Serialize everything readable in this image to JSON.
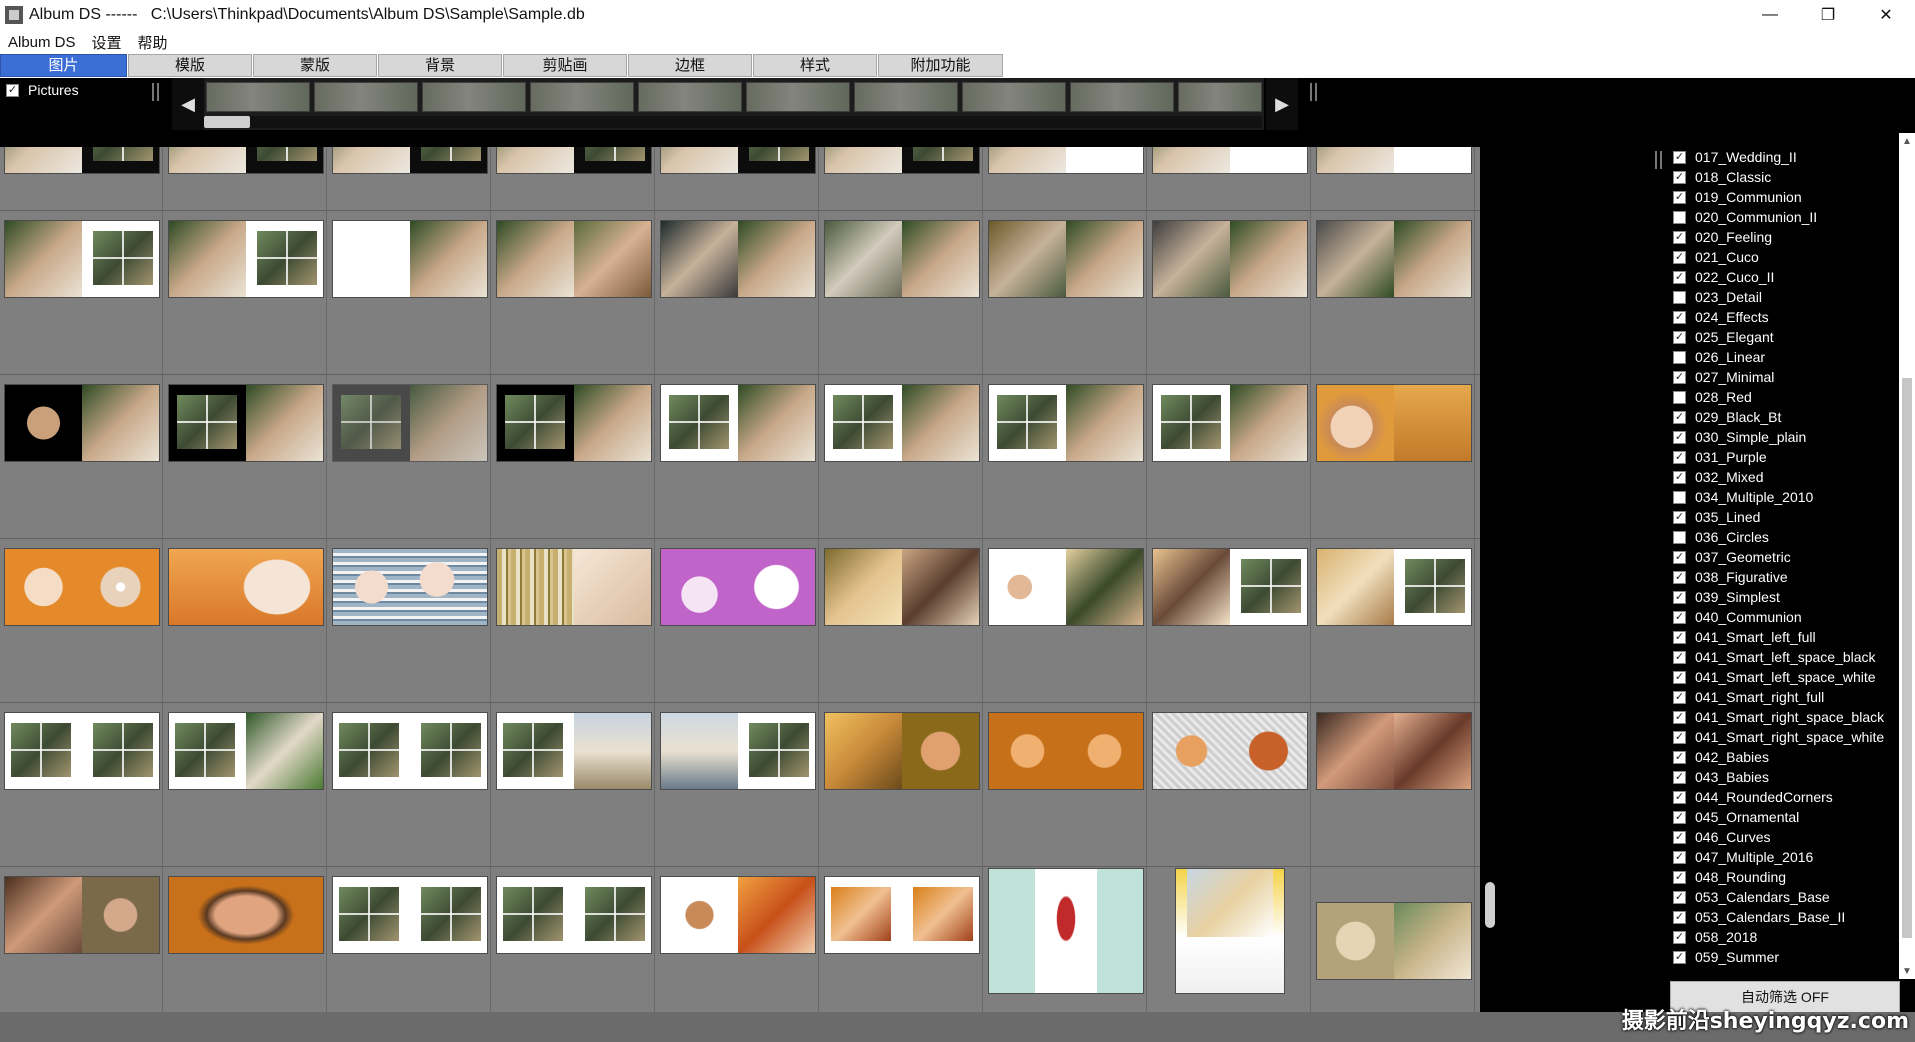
{
  "window": {
    "title": "Album DS ------   C:\\Users\\Thinkpad\\Documents\\Album DS\\Sample\\Sample.db",
    "minimize": "—",
    "maximize": "❐",
    "close": "✕"
  },
  "menu": [
    "Album DS",
    "设置",
    "帮助"
  ],
  "tabs": [
    "图片",
    "模版",
    "蒙版",
    "背景",
    "剪贴画",
    "边框",
    "样式",
    "附加功能"
  ],
  "pictures_label": "Pictures",
  "strip": {
    "left_arrow": "◀",
    "right_arrow": "▶"
  },
  "templates": [
    {
      "label": "017_Wedding_II",
      "checked": true
    },
    {
      "label": "018_Classic",
      "checked": true
    },
    {
      "label": "019_Communion",
      "checked": true
    },
    {
      "label": "020_Communion_II",
      "checked": false
    },
    {
      "label": "020_Feeling",
      "checked": true
    },
    {
      "label": "021_Cuco",
      "checked": true
    },
    {
      "label": "022_Cuco_II",
      "checked": true
    },
    {
      "label": "023_Detail",
      "checked": false
    },
    {
      "label": "024_Effects",
      "checked": true
    },
    {
      "label": "025_Elegant",
      "checked": true
    },
    {
      "label": "026_Linear",
      "checked": false
    },
    {
      "label": "027_Minimal",
      "checked": true
    },
    {
      "label": "028_Red",
      "checked": false
    },
    {
      "label": "029_Black_Bt",
      "checked": true
    },
    {
      "label": "030_Simple_plain",
      "checked": true
    },
    {
      "label": "031_Purple",
      "checked": true
    },
    {
      "label": "032_Mixed",
      "checked": true
    },
    {
      "label": "034_Multiple_2010",
      "checked": false
    },
    {
      "label": "035_Lined",
      "checked": true
    },
    {
      "label": "036_Circles",
      "checked": false
    },
    {
      "label": "037_Geometric",
      "checked": true
    },
    {
      "label": "038_Figurative",
      "checked": true
    },
    {
      "label": "039_Simplest",
      "checked": true
    },
    {
      "label": "040_Communion",
      "checked": true
    },
    {
      "label": "041_Smart_left_full",
      "checked": true
    },
    {
      "label": "041_Smart_left_space_black",
      "checked": true
    },
    {
      "label": "041_Smart_left_space_white",
      "checked": true
    },
    {
      "label": "041_Smart_right_full",
      "checked": true
    },
    {
      "label": "041_Smart_right_space_black",
      "checked": true
    },
    {
      "label": "041_Smart_right_space_white",
      "checked": true
    },
    {
      "label": "042_Babies",
      "checked": true
    },
    {
      "label": "043_Babies",
      "checked": true
    },
    {
      "label": "044_RoundedCorners",
      "checked": true
    },
    {
      "label": "045_Ornamental",
      "checked": true
    },
    {
      "label": "046_Curves",
      "checked": true
    },
    {
      "label": "047_Multiple_2016",
      "checked": true
    },
    {
      "label": "048_Rounding",
      "checked": true
    },
    {
      "label": "053_Calendars_Base",
      "checked": true
    },
    {
      "label": "053_Calendars_Base_II",
      "checked": true
    },
    {
      "label": "058_2018",
      "checked": true
    },
    {
      "label": "059_Summer",
      "checked": true
    }
  ],
  "auto_filter": "自动筛选 OFF",
  "watermark": "摄影前沿sheyingqyz.com",
  "colors": {
    "active_tab": "#3b6fd6",
    "grid_bg": "#7f7f7f",
    "panel_bg": "#000000"
  }
}
